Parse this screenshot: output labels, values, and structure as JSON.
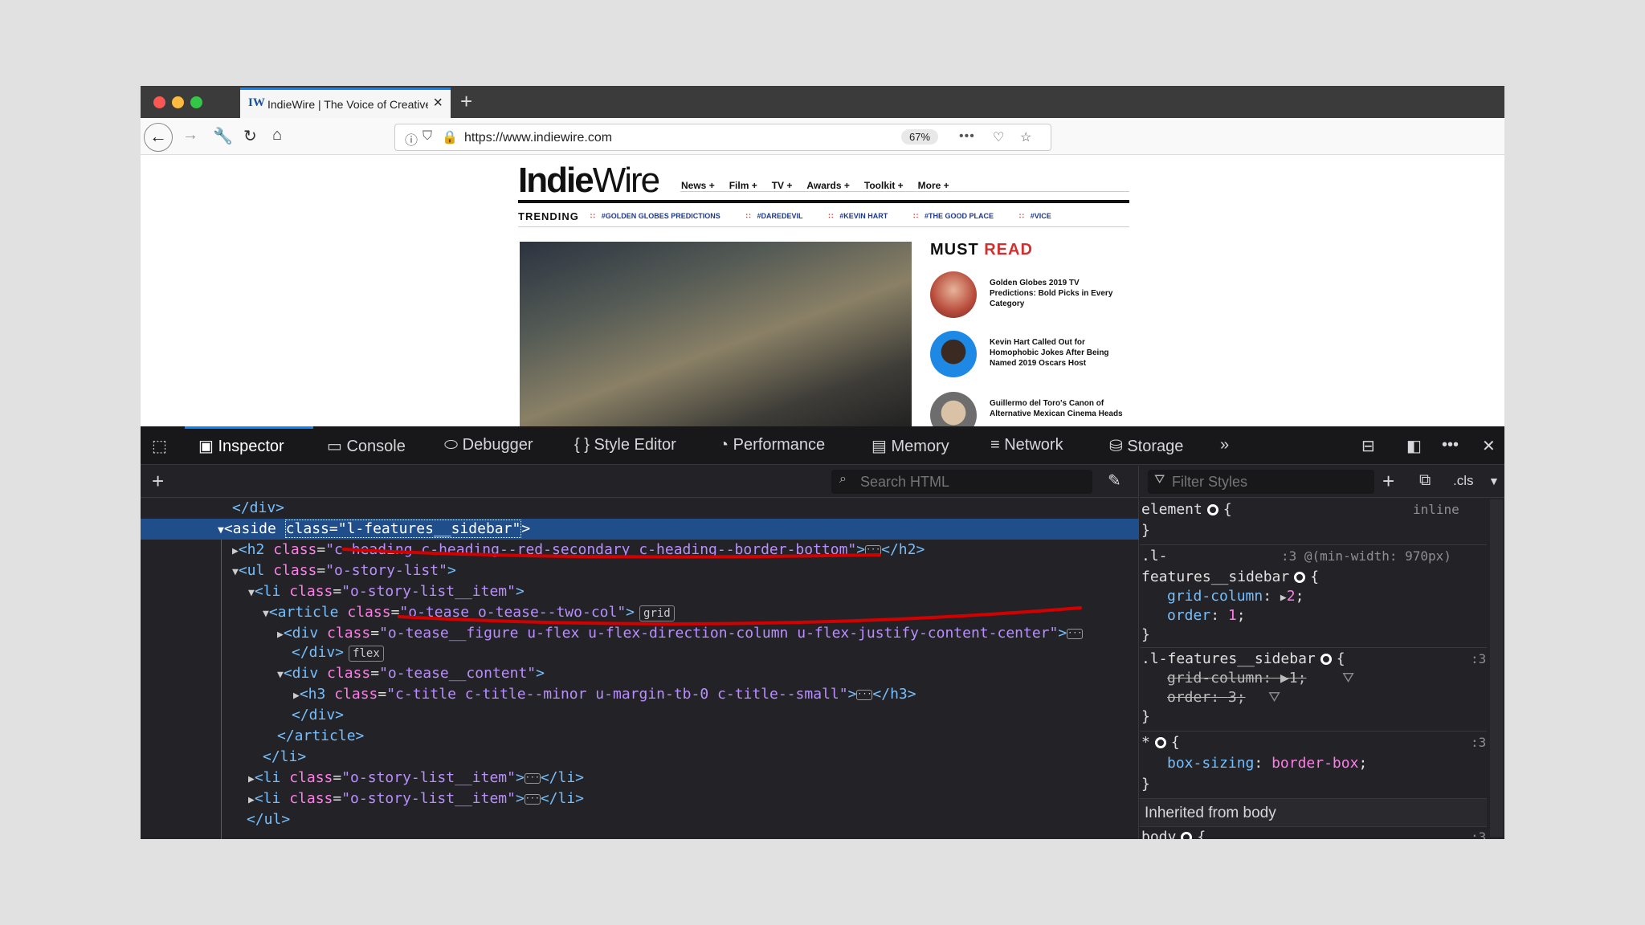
{
  "browser": {
    "tab_title": "IndieWire | The Voice of Creative Independence",
    "tab_favicon": "IW",
    "new_tab_label": "+",
    "url": "https://www.indiewire.com",
    "zoom": "67%",
    "more_label": "•••"
  },
  "site": {
    "logo_bold": "Indie",
    "logo_light": "Wire",
    "nav": [
      "News",
      "Film",
      "TV",
      "Awards",
      "Toolkit",
      "More"
    ],
    "trending_label": "TRENDING",
    "trending": [
      "#GOLDEN GLOBES PREDICTIONS",
      "#DAREDEVIL",
      "#KEVIN HART",
      "#THE GOOD PLACE",
      "#VICE"
    ],
    "must_read_a": "MUST",
    "must_read_b": "READ",
    "must_read_items": [
      "Golden Globes 2019 TV Predictions: Bold Picks in Every Category",
      "Kevin Hart Called Out for Homophobic Jokes After Being Named 2019 Oscars Host",
      "Guillermo del Toro's Canon of Alternative Mexican Cinema Heads"
    ]
  },
  "devtools": {
    "tabs": [
      "Inspector",
      "Console",
      "Debugger",
      "Style Editor",
      "Performance",
      "Memory",
      "Network",
      "Storage"
    ],
    "search_placeholder": "Search HTML",
    "filter_placeholder": "Filter Styles",
    "cls_label": ".cls",
    "markup": {
      "l0": "</div>",
      "l1_tag": "<aside",
      "l1_attr": "class",
      "l1_val": "\"l-features__sidebar\"",
      "l2_attr": "class",
      "l2_val": "\"c-heading c-heading--red-secondary c-heading--border-bottom\"",
      "l3_val": "\"o-story-list\"",
      "l4_val": "\"o-story-list__item\"",
      "l5_val": "\"o-tease o-tease--two-col\"",
      "l5_badge": "grid",
      "l6_val": "\"o-tease__figure u-flex u-flex-direction-column u-flex-justify-content-center\"",
      "l7_badge": "flex",
      "l8_val": "\"o-tease__content\"",
      "l9_val": "\"c-title c-title--minor u-margin-tb-0 c-title--small\"",
      "l10": "</div>",
      "l11": "</article>",
      "l12": "</li>",
      "l13_val": "\"o-story-list__item\"",
      "l14_val": "\"o-story-list__item\"",
      "l15": "</ul>"
    },
    "rules": {
      "element_sel": "element",
      "element_src": "inline",
      "r1_sel_a": ".l-",
      "r1_src": ":3 @(min-width: 970px)",
      "r1_sel_b": "features__sidebar",
      "r1_p1": "grid-column",
      "r1_v1": "2",
      "r1_p2": "order",
      "r1_v2": "1",
      "r2_sel": ".l-features__sidebar",
      "r2_src": ":3",
      "r2_p1": "grid-column",
      "r2_v1": "1",
      "r2_p2": "order",
      "r2_v2": "3",
      "r3_sel": "*",
      "r3_src": ":3",
      "r3_p1": "box-sizing",
      "r3_v1": "border-box",
      "inherited": "Inherited from body",
      "body_sel": "body",
      "body_src": ":3"
    }
  },
  "colors": {
    "accent": "#0a84ff",
    "annotation": "#d40000",
    "selection": "#204e8a"
  }
}
